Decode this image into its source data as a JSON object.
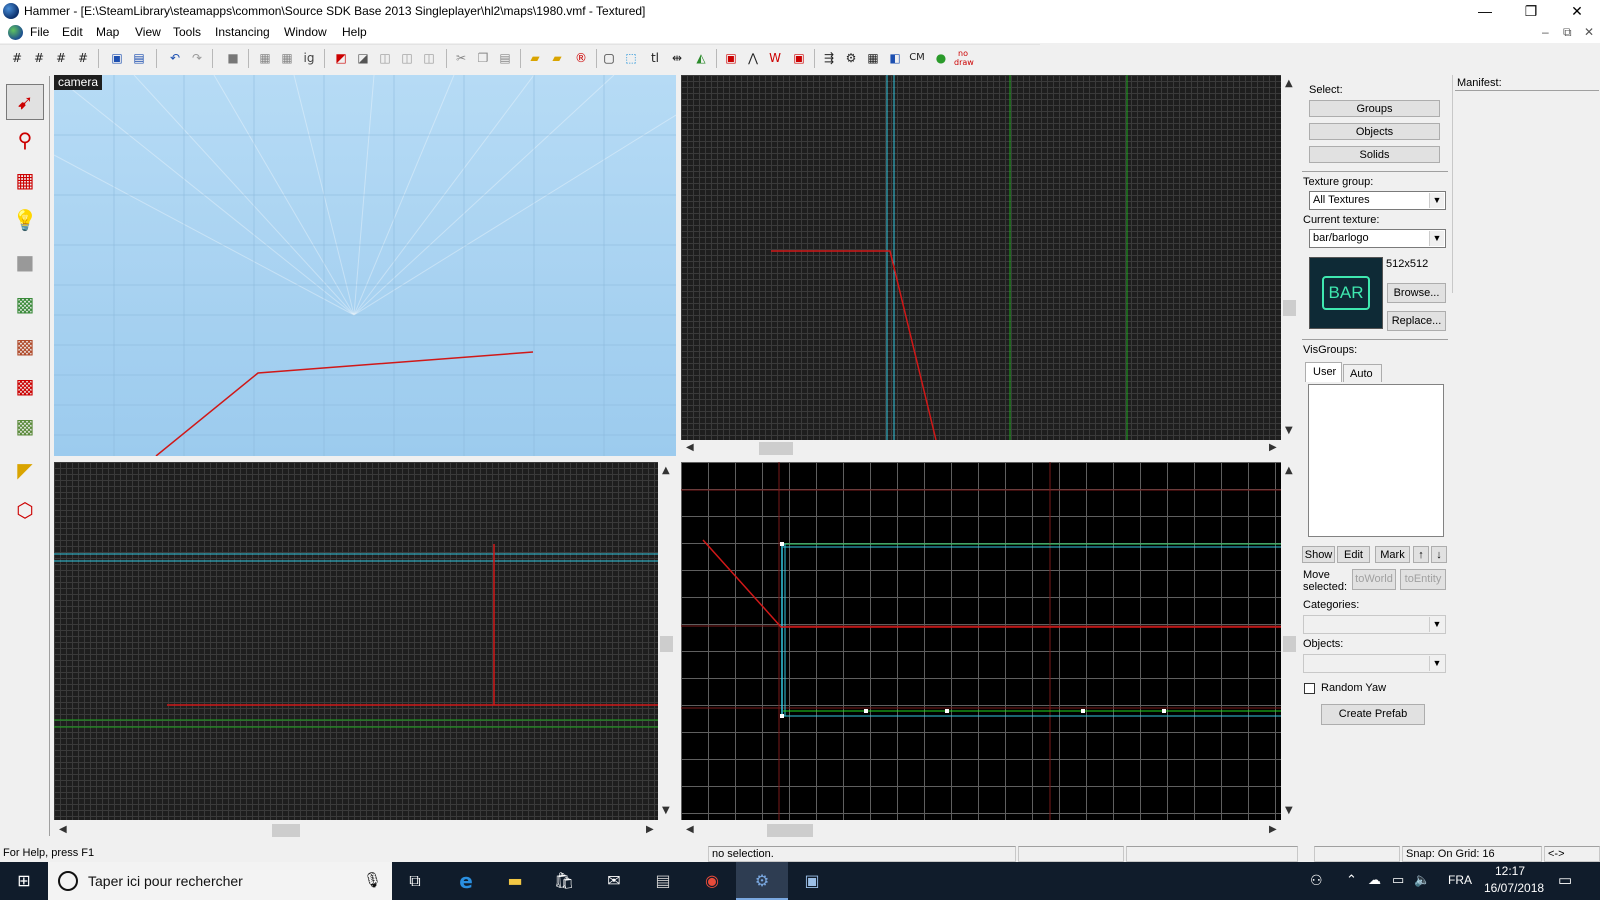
{
  "window": {
    "title": "Hammer - [E:\\SteamLibrary\\steamapps\\common\\Source SDK Base 2013 Singleplayer\\hl2\\maps\\1980.vmf - Textured]",
    "minimize": "—",
    "maximize": "❐",
    "close": "✕"
  },
  "menu": [
    "File",
    "Edit",
    "Map",
    "View",
    "Tools",
    "Instancing",
    "Window",
    "Help"
  ],
  "mdi_controls": [
    "–",
    "⧉",
    "✕"
  ],
  "viewports": {
    "camera_label": "camera"
  },
  "right_panel": {
    "select_label": "Select:",
    "select_buttons": [
      "Groups",
      "Objects",
      "Solids"
    ],
    "texture_group_label": "Texture group:",
    "texture_group_value": "All Textures",
    "current_texture_label": "Current texture:",
    "current_texture_value": "bar/barlogo",
    "texture_size": "512x512",
    "texture_preview_text": "BAR",
    "browse": "Browse...",
    "replace": "Replace...",
    "visgroups_label": "VisGroups:",
    "tabs": [
      "User",
      "Auto"
    ],
    "visgroup_buttons": [
      "Show",
      "Edit",
      "Mark",
      "↑",
      "↓"
    ],
    "move_selected_label": "Move selected:",
    "to_world": "toWorld",
    "to_entity": "toEntity",
    "categories_label": "Categories:",
    "objects_label": "Objects:",
    "random_yaw": "Random Yaw",
    "create_prefab": "Create Prefab"
  },
  "manifest": {
    "label": "Manifest:"
  },
  "status": {
    "help": "For Help, press F1",
    "selection": "no selection.",
    "snap": "Snap: On Grid: 16",
    "arrows": "<->"
  },
  "taskbar": {
    "search_placeholder": "Taper ici pour rechercher",
    "language": "FRA",
    "time": "12:17",
    "date": "16/07/2018"
  },
  "colors": {
    "selection_red": "#d01818",
    "axis_cyan": "#33c8e0",
    "axis_green": "#1fa81f"
  }
}
